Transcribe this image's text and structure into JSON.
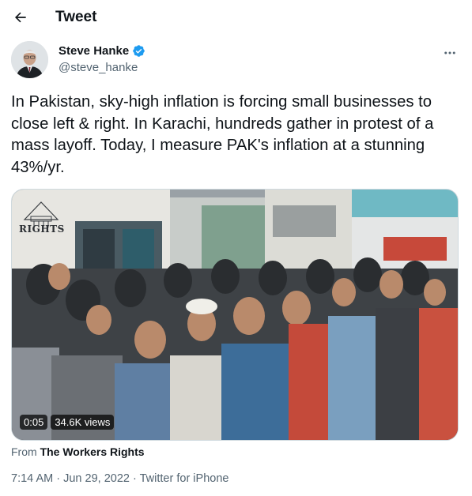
{
  "header": {
    "title": "Tweet"
  },
  "author": {
    "name": "Steve Hanke",
    "handle": "@steve_hanke"
  },
  "tweet": {
    "text": "In Pakistan, sky-high inflation is forcing small businesses to close left & right. In Karachi, hundreds gather in protest of a mass layoff. Today, I measure PAK's inflation at a stunning 43%/yr."
  },
  "media": {
    "logo_text": "RIGHTS",
    "duration": "0:05",
    "views": "34.6K views"
  },
  "source": {
    "prefix": "From",
    "name": "The Workers Rights"
  },
  "meta": {
    "time": "7:14 AM",
    "date": "Jun 29, 2022",
    "client": "Twitter for iPhone"
  },
  "colors": {
    "text": "#0f1419",
    "secondary": "#536471",
    "verified": "#1d9bf0"
  },
  "icons": {
    "back": "arrow-left-icon",
    "verified": "verified-badge-icon",
    "more": "more-dots-icon"
  }
}
